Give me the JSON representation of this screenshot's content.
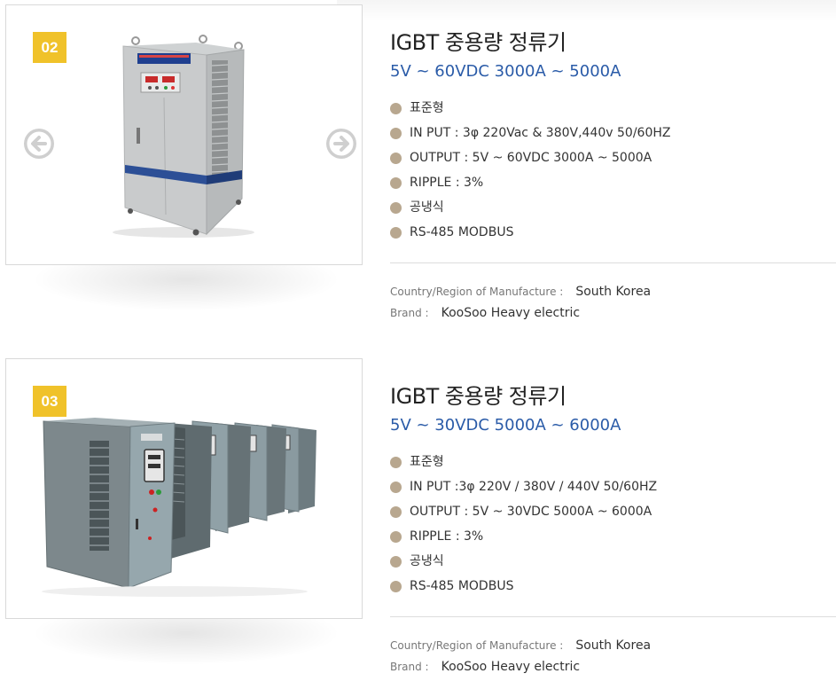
{
  "products": [
    {
      "badge": "02",
      "title": "IGBT 중용량 정류기",
      "subtitle": "5V ~ 60VDC 3000A ~ 5000A",
      "specs": [
        "표준형",
        "IN PUT : 3φ 220Vac & 380V,440v 50/60HZ",
        "OUTPUT : 5V ~ 60VDC 3000A ~ 5000A",
        "RIPPLE : 3%",
        "공냉식",
        "RS-485 MODBUS"
      ],
      "country_label": "Country/Region of Manufacture :",
      "country_value": "South Korea",
      "brand_label": "Brand :",
      "brand_value": "KooSoo Heavy electric",
      "image_icon": "rectifier-cabinet-single",
      "nav_prev_icon": "arrow-left-circle-icon",
      "nav_next_icon": "arrow-right-circle-icon"
    },
    {
      "badge": "03",
      "title": "IGBT 중용량 정류기",
      "subtitle": "5V ~ 30VDC 5000A ~ 6000A",
      "specs": [
        "표준형",
        "IN PUT :3φ 220V / 380V / 440V 50/60HZ",
        "OUTPUT : 5V ~ 30VDC 5000A ~ 6000A",
        "RIPPLE : 3%",
        "공냉식",
        "RS-485 MODBUS"
      ],
      "country_label": "Country/Region of Manufacture :",
      "country_value": "South Korea",
      "brand_label": "Brand :",
      "brand_value": "KooSoo Heavy electric",
      "image_icon": "rectifier-cabinet-row"
    }
  ],
  "colors": {
    "badge": "#f0c22a",
    "subtitle": "#2a5ba8",
    "bullet": "#b8a78f",
    "arrow": "#cfcfcf"
  }
}
